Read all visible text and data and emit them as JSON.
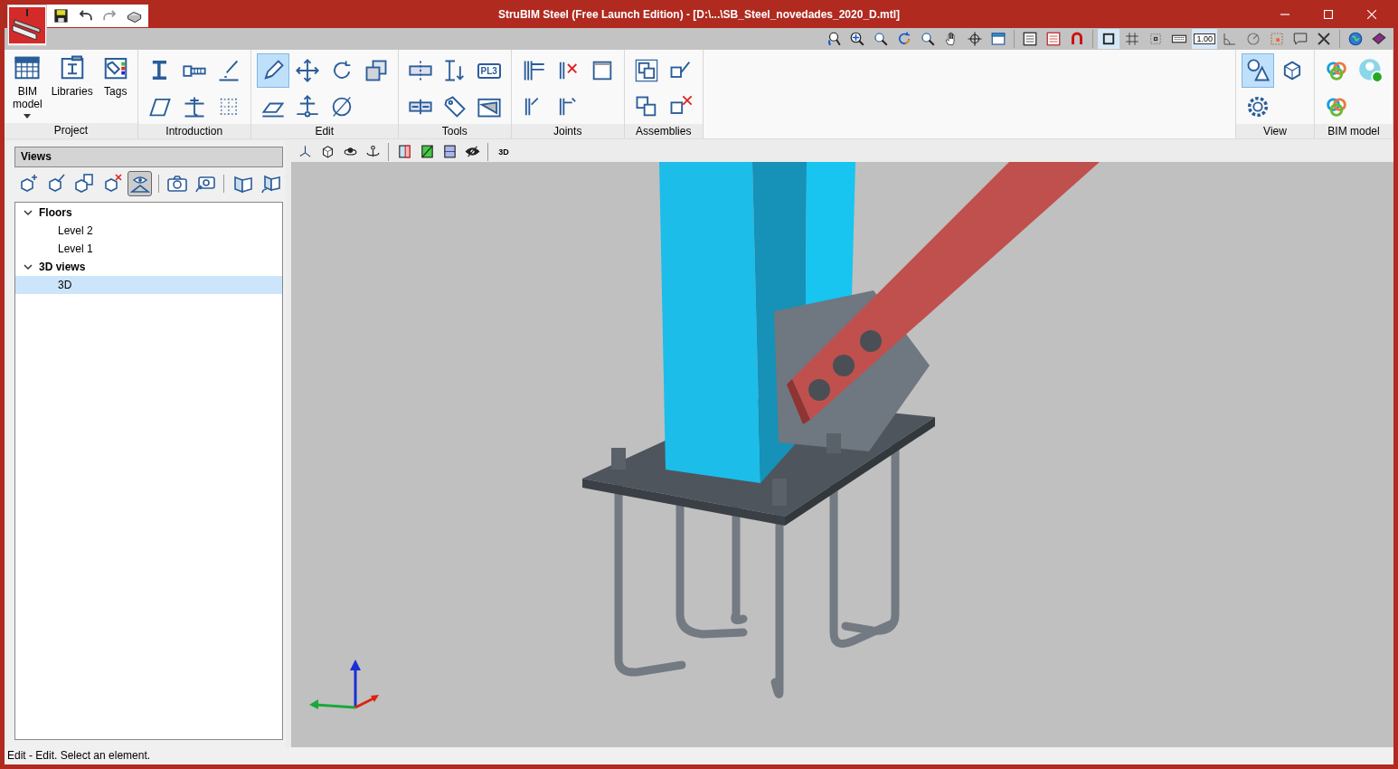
{
  "window": {
    "title": "StruBIM Steel (Free Launch Edition) - [D:\\...\\SB_Steel_novedades_2020_D.mtl]"
  },
  "top_toolbar": [
    {
      "selected": false
    },
    {
      "selected": false
    },
    {
      "selected": false
    },
    {
      "selected": false
    },
    {
      "selected": false
    },
    {
      "selected": false
    },
    {
      "selected": false
    },
    {
      "selected": false
    },
    {
      "selected": false
    },
    {
      "selected": false
    },
    {
      "selected": false
    },
    {
      "selected": true
    },
    {
      "selected": false
    },
    {
      "selected": false
    },
    {
      "selected": false
    },
    {
      "selected": true,
      "label": "1.00"
    },
    {
      "selected": false
    },
    {
      "selected": false
    },
    {
      "selected": false
    },
    {
      "selected": false
    },
    {
      "selected": false
    },
    {
      "selected": false
    },
    {
      "selected": false
    }
  ],
  "ribbon": [
    {
      "label": "Project",
      "items": [
        {
          "label": "BIM model",
          "selected": false,
          "dropdown": true
        },
        {
          "label": "Libraries",
          "selected": false
        },
        {
          "label": "Tags",
          "selected": false
        }
      ]
    },
    {
      "label": "Introduction",
      "items": [
        {
          "selected": false
        },
        {
          "selected": false
        },
        {
          "selected": false
        },
        {
          "selected": false
        },
        {
          "selected": false
        },
        {
          "selected": false
        }
      ]
    },
    {
      "label": "Edit",
      "items": [
        {
          "selected": true
        },
        {
          "selected": false
        },
        {
          "selected": false
        },
        {
          "selected": false
        },
        {
          "selected": false
        },
        {
          "selected": false
        },
        {
          "selected": false
        }
      ]
    },
    {
      "label": "Tools",
      "items": [
        {
          "selected": false
        },
        {
          "selected": false
        },
        {
          "selected": false
        },
        {
          "selected": false
        },
        {
          "selected": false,
          "label": "PL3"
        },
        {
          "selected": false
        }
      ]
    },
    {
      "label": "Joints",
      "items": [
        {
          "selected": false
        },
        {
          "selected": false
        },
        {
          "selected": false
        },
        {
          "selected": false
        },
        {
          "selected": false
        }
      ]
    },
    {
      "label": "Assemblies",
      "items": [
        {
          "selected": false
        },
        {
          "selected": false
        },
        {
          "selected": false
        },
        {
          "selected": false
        }
      ]
    },
    {
      "label": "View",
      "items": [
        {
          "selected": true
        },
        {
          "selected": false
        },
        {
          "selected": false
        }
      ]
    },
    {
      "label": "BIM model",
      "items": [
        {
          "selected": false
        },
        {
          "selected": false
        },
        {
          "selected": false
        }
      ]
    }
  ],
  "views_panel": {
    "title": "Views",
    "toolbar": [
      {
        "selected": false
      },
      {
        "selected": false
      },
      {
        "selected": false
      },
      {
        "selected": false
      },
      {
        "selected": true
      },
      {
        "selected": false
      },
      {
        "selected": false
      },
      {
        "selected": false
      },
      {
        "selected": false
      }
    ],
    "tree": [
      {
        "label": "Floors",
        "expanded": true,
        "selected": false,
        "children": [
          {
            "label": "Level 2",
            "selected": false
          },
          {
            "label": "Level 1",
            "selected": false
          }
        ]
      },
      {
        "label": "3D views",
        "expanded": true,
        "selected": false,
        "children": [
          {
            "label": "3D",
            "selected": true
          }
        ]
      }
    ]
  },
  "viewport_toolbar": [
    {
      "selected": false
    },
    {
      "selected": false
    },
    {
      "selected": false
    },
    {
      "selected": false
    },
    {
      "selected": false
    },
    {
      "selected": false
    },
    {
      "selected": false
    },
    {
      "selected": false
    },
    {
      "selected": false,
      "label": "3D"
    }
  ],
  "status_bar": "Edit - Edit. Select an element."
}
